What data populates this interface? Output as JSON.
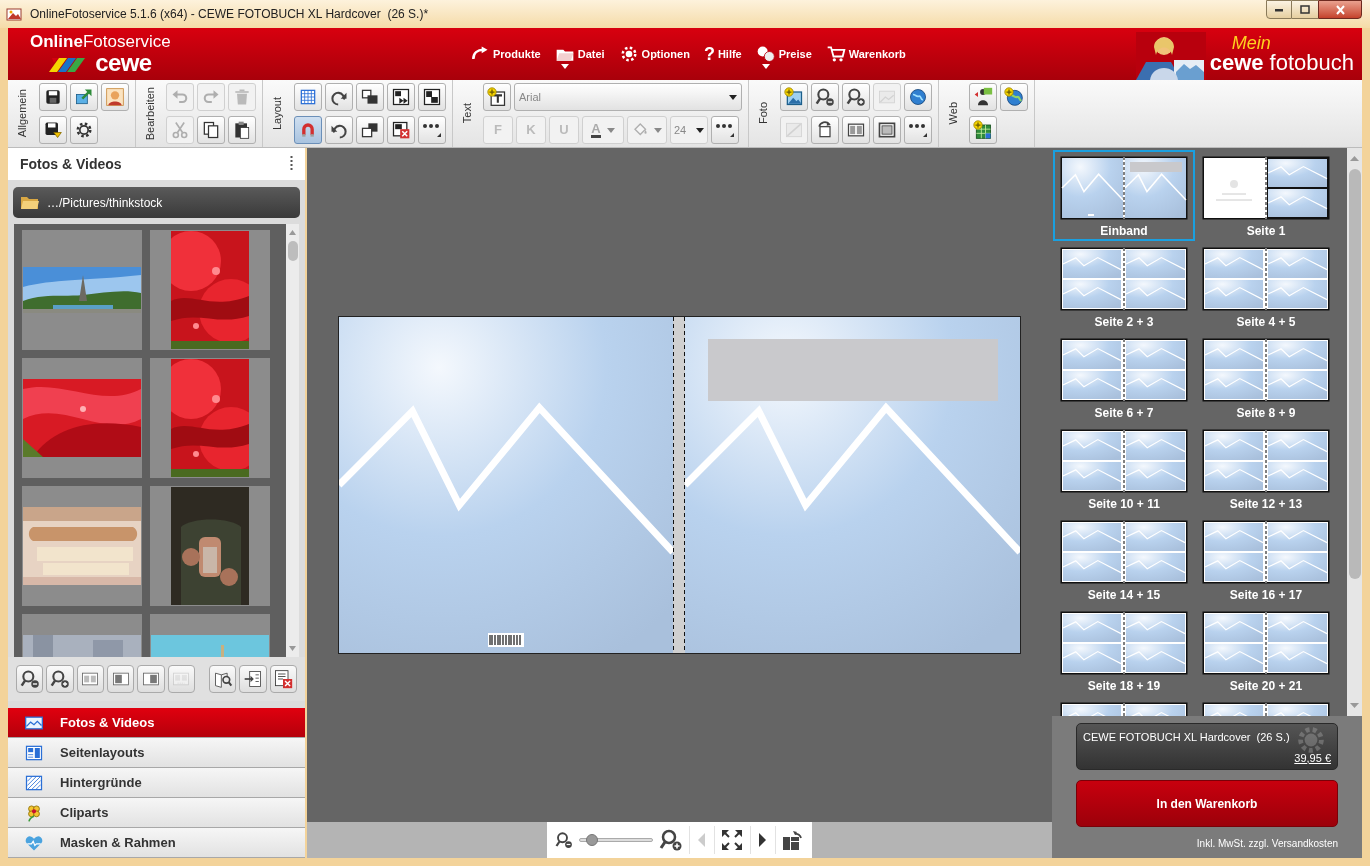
{
  "window": {
    "title": "OnlineFotoservice 5.1.6 (x64) - CEWE FOTOBUCH XL Hardcover  (26 S.)*"
  },
  "logo": {
    "bold": "Online",
    "rest": "Fotoservice",
    "brand": "cewe"
  },
  "menu": [
    {
      "label": "Produkte",
      "kind": "products",
      "dropdown": false
    },
    {
      "label": "Datei",
      "kind": "file",
      "dropdown": true
    },
    {
      "label": "Optionen",
      "kind": "options",
      "dropdown": false
    },
    {
      "label": "Hilfe",
      "kind": "help",
      "glyph": "?",
      "dropdown": false
    },
    {
      "label": "Preise",
      "kind": "prices",
      "dropdown": true
    },
    {
      "label": "Warenkorb",
      "kind": "cart",
      "dropdown": false
    }
  ],
  "brand": {
    "prefix": "Mein",
    "bold": "cewe",
    "rest": "fotobuch"
  },
  "toolbar": [
    {
      "label": "Allgemein",
      "rows": [
        [
          {
            "kind": "save",
            "disabled": false,
            "pressed": false
          },
          {
            "kind": "export",
            "disabled": false,
            "pressed": false
          },
          {
            "kind": "avatar",
            "disabled": false,
            "pressed": false
          }
        ],
        [
          {
            "kind": "save-as",
            "disabled": false,
            "pressed": false
          },
          {
            "kind": "settings",
            "disabled": false,
            "pressed": false
          }
        ]
      ]
    },
    {
      "label": "Bearbeiten",
      "rows": [
        [
          {
            "kind": "undo",
            "disabled": true,
            "pressed": false
          },
          {
            "kind": "redo",
            "disabled": true,
            "pressed": false
          },
          {
            "kind": "delete",
            "disabled": true,
            "pressed": false
          }
        ],
        [
          {
            "kind": "cut",
            "disabled": true,
            "pressed": false
          },
          {
            "kind": "copy",
            "disabled": false,
            "pressed": false
          },
          {
            "kind": "paste",
            "disabled": false,
            "pressed": false
          }
        ]
      ]
    },
    {
      "label": "Layout",
      "rows": [
        [
          {
            "kind": "grid",
            "disabled": false,
            "pressed": false
          },
          {
            "kind": "rotate-left",
            "disabled": false,
            "pressed": false
          },
          {
            "kind": "arrange-back",
            "disabled": false,
            "pressed": false
          },
          {
            "kind": "page-next",
            "disabled": false,
            "pressed": false
          },
          {
            "kind": "layout",
            "disabled": false,
            "pressed": false
          }
        ],
        [
          {
            "kind": "magnet",
            "disabled": false,
            "pressed": true
          },
          {
            "kind": "rotate-right",
            "disabled": false,
            "pressed": false
          },
          {
            "kind": "arrange-front",
            "disabled": false,
            "pressed": false
          },
          {
            "kind": "remove-frame",
            "disabled": false,
            "pressed": false
          },
          {
            "kind": "more",
            "disabled": false,
            "pressed": false
          }
        ]
      ]
    },
    {
      "label": "Text",
      "rows": [
        [
          {
            "kind": "add-text",
            "disabled": false,
            "pressed": false
          },
          {
            "kind": "font-select",
            "value": "Arial",
            "disabled": false,
            "pressed": false
          }
        ],
        [
          {
            "kind": "letter",
            "label": "F",
            "disabled": true,
            "pressed": false
          },
          {
            "kind": "letter",
            "label": "K",
            "disabled": true,
            "pressed": false
          },
          {
            "kind": "letter",
            "label": "U",
            "disabled": true,
            "pressed": false
          },
          {
            "kind": "font-color",
            "label": "A",
            "disabled": true,
            "pressed": false
          },
          {
            "kind": "fill",
            "disabled": true,
            "pressed": false
          },
          {
            "kind": "size-select",
            "value": "24",
            "disabled": true,
            "pressed": false
          },
          {
            "kind": "more",
            "disabled": false,
            "pressed": false
          }
        ]
      ]
    },
    {
      "label": "Foto",
      "rows": [
        [
          {
            "kind": "add-photo",
            "disabled": false,
            "pressed": false
          },
          {
            "kind": "zoom-out",
            "disabled": false,
            "pressed": false
          },
          {
            "kind": "zoom-in",
            "disabled": false,
            "pressed": false
          },
          {
            "kind": "effect",
            "disabled": true,
            "pressed": false
          },
          {
            "kind": "globe",
            "disabled": false,
            "pressed": false
          }
        ],
        [
          {
            "kind": "enhance",
            "disabled": true,
            "pressed": false
          },
          {
            "kind": "rotate-photo",
            "disabled": false,
            "pressed": false
          },
          {
            "kind": "split",
            "disabled": false,
            "pressed": false
          },
          {
            "kind": "frame",
            "disabled": false,
            "pressed": false
          },
          {
            "kind": "more",
            "disabled": false,
            "pressed": false
          }
        ]
      ]
    },
    {
      "label": "Web",
      "rows": [
        [
          {
            "kind": "web-person",
            "disabled": false,
            "pressed": false
          },
          {
            "kind": "web-globe",
            "disabled": false,
            "pressed": false
          }
        ],
        [
          {
            "kind": "web-grid",
            "disabled": false,
            "pressed": false
          }
        ]
      ]
    }
  ],
  "left_panel": {
    "title": "Fotos & Videos",
    "folder": "…/Pictures/thinkstock",
    "tools": [
      {
        "kind": "zoom-out",
        "disabled": false
      },
      {
        "kind": "zoom-in",
        "disabled": false
      },
      {
        "kind": "layout-a",
        "disabled": false
      },
      {
        "kind": "layout-b",
        "disabled": false
      },
      {
        "kind": "layout-c",
        "disabled": false
      },
      {
        "kind": "layout-d",
        "disabled": true
      },
      {
        "kind": "book-search",
        "disabled": false
      },
      {
        "kind": "import",
        "disabled": false
      },
      {
        "kind": "remove-list",
        "disabled": false
      }
    ],
    "nav": [
      {
        "label": "Fotos & Videos",
        "kind": "photos",
        "selected": true
      },
      {
        "label": "Seitenlayouts",
        "kind": "layouts",
        "selected": false
      },
      {
        "label": "Hintergründe",
        "kind": "backgrounds",
        "selected": false
      },
      {
        "label": "Cliparts",
        "kind": "cliparts",
        "selected": false
      },
      {
        "label": "Masken & Rahmen",
        "kind": "masks",
        "selected": false
      }
    ]
  },
  "zoom_bar": {
    "level": 0.1,
    "prev_disabled": true,
    "next_disabled": false
  },
  "pages": [
    {
      "kind": "cover",
      "label": "Einband",
      "selected": true
    },
    {
      "kind": "first",
      "label": "Seite 1",
      "selected": false
    },
    {
      "kind": "spread",
      "label": "Seite 2 + 3",
      "selected": false
    },
    {
      "kind": "spread",
      "label": "Seite 4 + 5",
      "selected": false
    },
    {
      "kind": "spread",
      "label": "Seite 6 + 7",
      "selected": false
    },
    {
      "kind": "spread",
      "label": "Seite 8 + 9",
      "selected": false
    },
    {
      "kind": "spread",
      "label": "Seite 10 + 11",
      "selected": false
    },
    {
      "kind": "spread",
      "label": "Seite 12 + 13",
      "selected": false
    },
    {
      "kind": "spread",
      "label": "Seite 14 + 15",
      "selected": false
    },
    {
      "kind": "spread",
      "label": "Seite 16 + 17",
      "selected": false
    },
    {
      "kind": "spread",
      "label": "Seite 18 + 19",
      "selected": false
    },
    {
      "kind": "spread",
      "label": "Seite 20 + 21",
      "selected": false
    },
    {
      "kind": "spread",
      "selected": false
    },
    {
      "kind": "spread",
      "selected": false
    }
  ],
  "cart": {
    "product": "CEWE FOTOBUCH XL Hardcover  (26 S.)",
    "price": "39,95 €",
    "button": "In den Warenkorb",
    "note": "Inkl. MwSt. zzgl. Versandkosten"
  }
}
